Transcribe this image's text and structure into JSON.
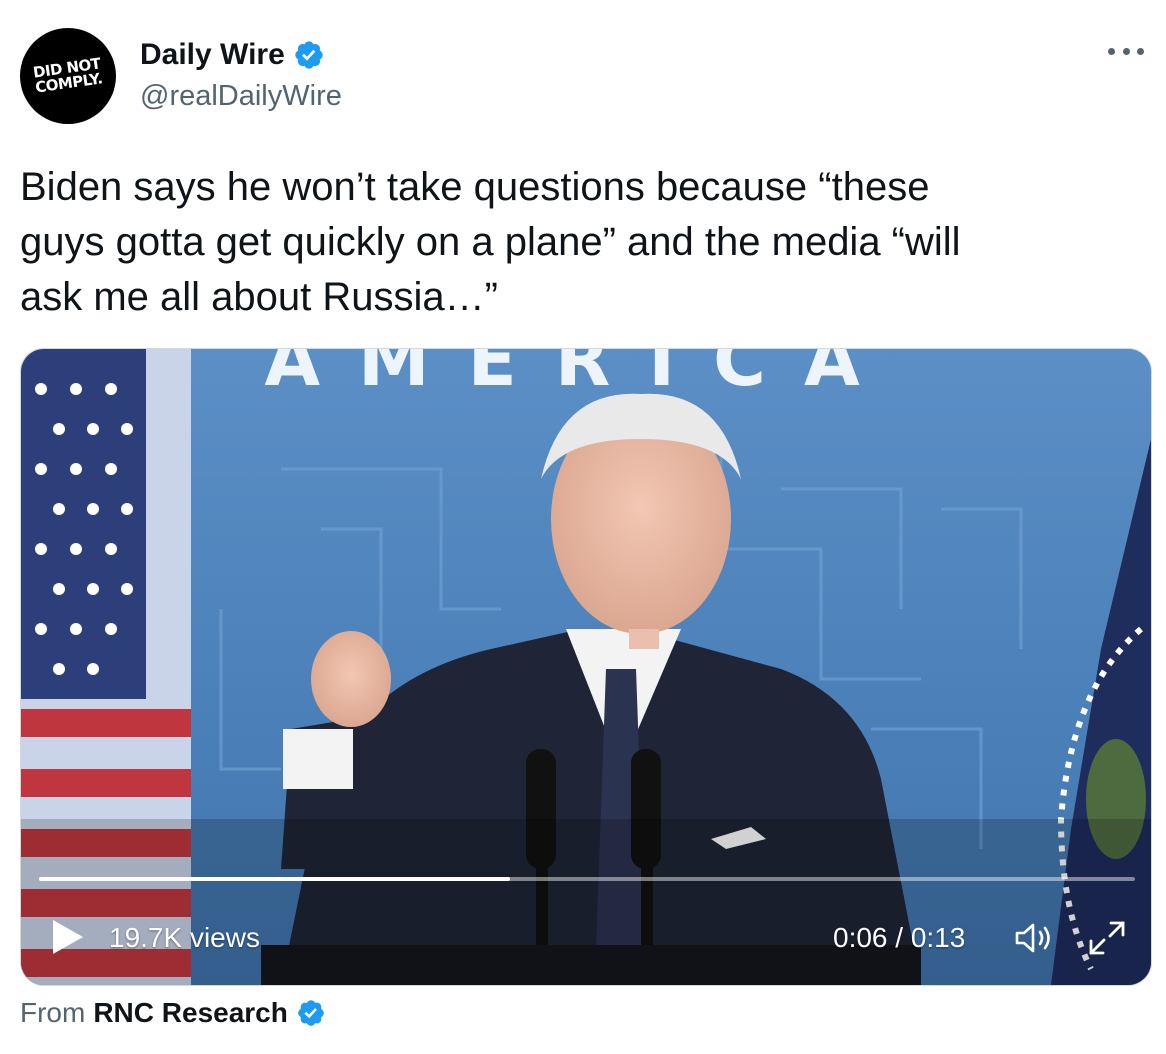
{
  "author": {
    "avatar_text": "DID NOT\nCOMPLY.",
    "display_name": "Daily Wire",
    "handle": "@realDailyWire",
    "verified": true
  },
  "tweet": {
    "text": "Biden says he won’t take questions because “these\nguys gotta get quickly on a plane” and the media “will\nask me all about Russia…”"
  },
  "video": {
    "views": "19.7K views",
    "time": "0:06 / 0:13",
    "progress": 0.43,
    "backdrop_text": "AMERICA",
    "controls": {
      "play_icon": "play-icon",
      "volume_icon": "volume-icon",
      "fullscreen_icon": "fullscreen-icon"
    }
  },
  "attribution": {
    "from_label": "From",
    "source_name": "RNC Research",
    "verified": true
  },
  "colors": {
    "verified_blue": "#1d9bf0",
    "secondary_text": "#536471",
    "primary_text": "#0f1419"
  }
}
